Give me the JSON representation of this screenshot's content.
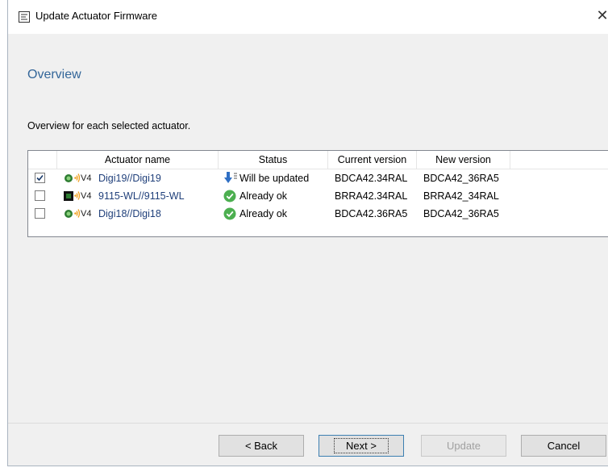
{
  "window": {
    "title": "Update Actuator Firmware",
    "close_glyph": "✕"
  },
  "page": {
    "heading": "Overview",
    "description": "Overview for each selected actuator."
  },
  "table": {
    "columns": [
      "Actuator name",
      "Status",
      "Current version",
      "New version"
    ],
    "rows": [
      {
        "checked": true,
        "device_icon": "green-dot-icon",
        "signal_icon": "wireless-signal-icon",
        "protocol": "V4",
        "name": "Digi19//Digi19",
        "status_icon": "download-arrow-icon",
        "status": "Will be updated",
        "current_version": "BDCA42.34RAL",
        "new_version": "BDCA42_36RA5"
      },
      {
        "checked": false,
        "device_icon": "black-square-icon",
        "signal_icon": "wireless-signal-icon",
        "protocol": "V4",
        "name": "9115-WL//9115-WL",
        "status_icon": "check-circle-icon",
        "status": "Already ok",
        "current_version": "BRRA42.34RAL",
        "new_version": "BRRA42_34RAL"
      },
      {
        "checked": false,
        "device_icon": "green-dot-icon",
        "signal_icon": "wireless-signal-icon",
        "protocol": "V4",
        "name": "Digi18//Digi18",
        "status_icon": "check-circle-icon",
        "status": "Already ok",
        "current_version": "BDCA42.36RA5",
        "new_version": "BDCA42_36RA5"
      }
    ]
  },
  "buttons": {
    "back": "< Back",
    "next": "Next >",
    "update": "Update",
    "cancel": "Cancel"
  },
  "colors": {
    "heading": "#336699",
    "name_link": "#1f3f7a",
    "check_green": "#4caf50",
    "arrow_blue": "#2f6fc4",
    "signal_orange": "#f0a020"
  }
}
